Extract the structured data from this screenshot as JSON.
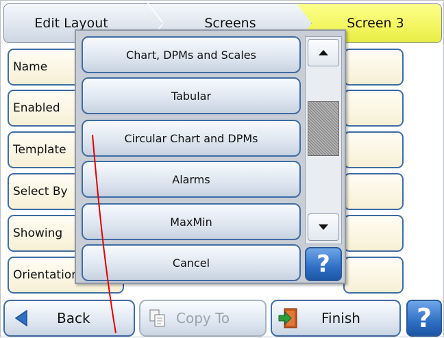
{
  "breadcrumb": [
    "Edit Layout",
    "Screens",
    "Screen 3"
  ],
  "fields": [
    "Name",
    "Enabled",
    "Template",
    "Select By",
    "Showing",
    "Orientation"
  ],
  "popup": {
    "options": [
      "Chart, DPMs and Scales",
      "Tabular",
      "Circular Chart and DPMs",
      "Alarms",
      "MaxMin",
      "Cancel"
    ],
    "help_label": "?"
  },
  "bottom_bar": {
    "back_label": "Back",
    "copy_label": "Copy To",
    "finish_label": "Finish",
    "help_label": "?"
  },
  "colors": {
    "active_tab": "#f3f65f",
    "button_border": "#3f6ca3",
    "help_blue": "#2f6fc4",
    "annotation_line": "#e00000"
  },
  "icons": [
    "triangle-left-icon",
    "copy-icon",
    "finish-exit-icon",
    "scroll-up-icon",
    "scroll-down-icon",
    "help-icon"
  ]
}
